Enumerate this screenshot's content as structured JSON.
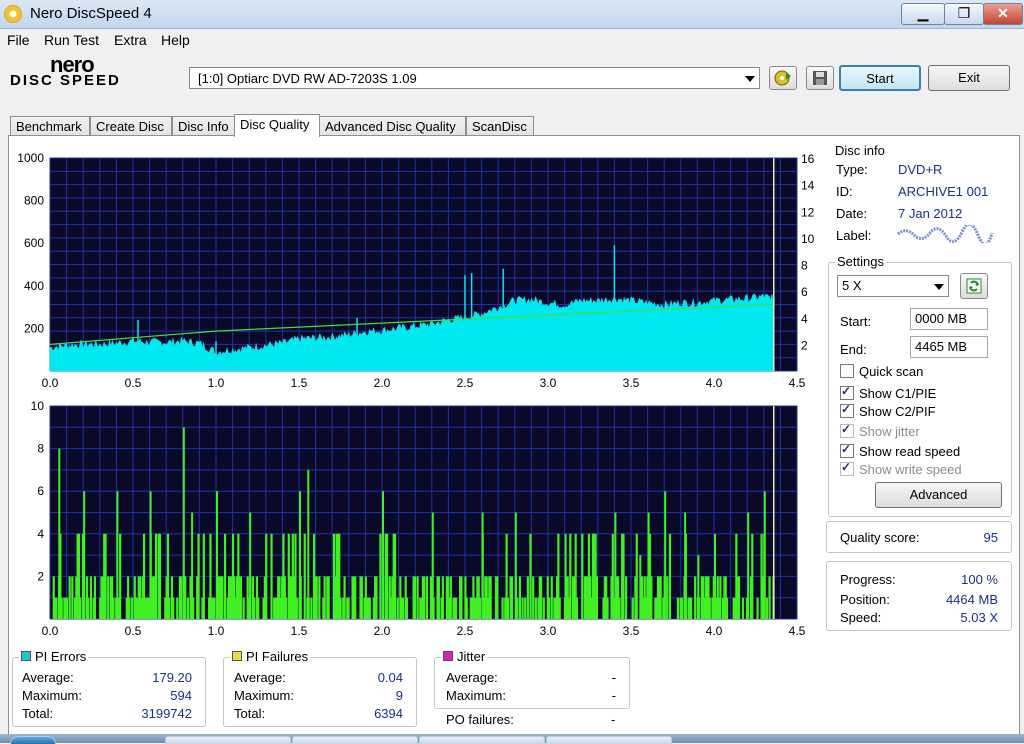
{
  "window": {
    "title": "Nero DiscSpeed 4",
    "min": "▁",
    "max": "❐",
    "close": "✕"
  },
  "menu": [
    "File",
    "Run Test",
    "Extra",
    "Help"
  ],
  "logo": {
    "line1": "nero",
    "line2": "DISC SPEED"
  },
  "toolbar": {
    "drive": "[1:0]   Optiarc DVD RW AD-7203S 1.09",
    "start_label": "Start",
    "exit_label": "Exit",
    "eject_icon": "disc-eject-icon",
    "save_icon": "floppy-save-icon"
  },
  "tabs": [
    "Benchmark",
    "Create Disc",
    "Disc Info",
    "Disc Quality",
    "Advanced Disc Quality",
    "ScanDisc"
  ],
  "active_tab": "Disc Quality",
  "disc_info": {
    "title": "Disc info",
    "type_label": "Type:",
    "type": "DVD+R",
    "id_label": "ID:",
    "id": "ARCHIVE1 001",
    "date_label": "Date:",
    "date": "7 Jan 2012",
    "label_label": "Label:"
  },
  "settings": {
    "title": "Settings",
    "speed": "5 X",
    "start_label": "Start:",
    "start": "0000 MB",
    "end_label": "End:",
    "end": "4465 MB",
    "quick_scan": "Quick scan",
    "show_c1": "Show C1/PIE",
    "show_c2": "Show C2/PIF",
    "show_jitter": "Show jitter",
    "show_read": "Show read speed",
    "show_write": "Show write speed",
    "advanced_label": "Advanced"
  },
  "quality": {
    "label": "Quality score:",
    "value": "95"
  },
  "progress": {
    "progress_label": "Progress:",
    "progress": "100 %",
    "position_label": "Position:",
    "position": "4464 MB",
    "speed_label": "Speed:",
    "speed": "5.03 X"
  },
  "pi_errors": {
    "title": "PI Errors",
    "avg_label": "Average:",
    "avg": "179.20",
    "max_label": "Maximum:",
    "max": "594",
    "total_label": "Total:",
    "total": "3199742",
    "color": "#1fc4d6"
  },
  "pi_failures": {
    "title": "PI Failures",
    "avg_label": "Average:",
    "avg": "0.04",
    "max_label": "Maximum:",
    "max": "9",
    "total_label": "Total:",
    "total": "6394",
    "color": "#e8e040"
  },
  "jitter": {
    "title": "Jitter",
    "avg_label": "Average:",
    "avg": "-",
    "max_label": "Maximum:",
    "max": "-",
    "po_label": "PO failures:",
    "po": "-",
    "color": "#d020d0"
  },
  "chart_data": [
    {
      "type": "area",
      "x_ticks": [
        "0.0",
        "0.5",
        "1.0",
        "1.5",
        "2.0",
        "2.5",
        "3.0",
        "3.5",
        "4.0",
        "4.5"
      ],
      "y_ticks_left": [
        "1000",
        "800",
        "600",
        "400",
        "200"
      ],
      "y_ticks_right": [
        "16",
        "14",
        "12",
        "10",
        "8",
        "6",
        "4",
        "2"
      ],
      "xlim": [
        0,
        4.5
      ],
      "ylim": [
        0,
        1000
      ],
      "y2lim": [
        0,
        16
      ],
      "series": [
        {
          "color": "#00e8f0",
          "x": [
            0.0,
            0.1,
            0.2,
            0.3,
            0.4,
            0.5,
            0.6,
            0.7,
            0.8,
            0.9,
            1.0,
            1.1,
            1.2,
            1.3,
            1.4,
            1.5,
            1.6,
            1.7,
            1.8,
            1.9,
            2.0,
            2.1,
            2.2,
            2.3,
            2.4,
            2.5,
            2.6,
            2.7,
            2.8,
            2.9,
            3.0,
            3.1,
            3.2,
            3.3,
            3.4,
            3.5,
            3.6,
            3.7,
            3.8,
            3.9,
            4.0,
            4.1,
            4.2,
            4.3,
            4.36
          ],
          "y": [
            110,
            120,
            125,
            125,
            130,
            140,
            135,
            135,
            140,
            130,
            90,
            100,
            110,
            120,
            130,
            150,
            155,
            160,
            170,
            185,
            190,
            200,
            210,
            220,
            240,
            250,
            270,
            300,
            330,
            335,
            320,
            310,
            330,
            330,
            340,
            330,
            320,
            310,
            320,
            320,
            330,
            335,
            340,
            350,
            340
          ]
        },
        {
          "color": "#40e040",
          "x": [
            0.0,
            0.5,
            1.0,
            1.5,
            2.0,
            2.5,
            3.0,
            3.5,
            4.0,
            4.36
          ],
          "y": [
            2.0,
            2.5,
            3.0,
            3.3,
            3.6,
            3.9,
            4.2,
            4.5,
            4.8,
            5.03
          ]
        }
      ],
      "spikes": [
        [
          0.53,
          240
        ],
        [
          1.0,
          140
        ],
        [
          1.85,
          250
        ],
        [
          2.5,
          450
        ],
        [
          2.54,
          460
        ],
        [
          2.73,
          480
        ],
        [
          3.4,
          590
        ],
        [
          4.2,
          330
        ]
      ]
    },
    {
      "type": "bar",
      "x_ticks": [
        "0.0",
        "0.5",
        "1.0",
        "1.5",
        "2.0",
        "2.5",
        "3.0",
        "3.5",
        "4.0",
        "4.5"
      ],
      "y_ticks_left": [
        "10",
        "8",
        "6",
        "4",
        "2"
      ],
      "xlim": [
        0,
        4.5
      ],
      "ylim": [
        0,
        10
      ],
      "series": [
        {
          "color": "#40f020",
          "peaks": [
            [
              0.05,
              8
            ],
            [
              0.2,
              6
            ],
            [
              0.4,
              6
            ],
            [
              0.6,
              6
            ],
            [
              0.8,
              9
            ],
            [
              0.85,
              5
            ],
            [
              1.0,
              6
            ],
            [
              1.2,
              5
            ],
            [
              1.5,
              6
            ],
            [
              1.55,
              7
            ],
            [
              2.0,
              6
            ],
            [
              2.3,
              5
            ],
            [
              2.6,
              5
            ],
            [
              2.8,
              5
            ],
            [
              3.1,
              4
            ],
            [
              3.4,
              5
            ],
            [
              3.55,
              3
            ],
            [
              3.6,
              5
            ],
            [
              3.7,
              6
            ],
            [
              3.82,
              5
            ],
            [
              3.9,
              3
            ],
            [
              4.0,
              4
            ],
            [
              4.2,
              5
            ],
            [
              4.3,
              6
            ]
          ]
        }
      ]
    }
  ]
}
